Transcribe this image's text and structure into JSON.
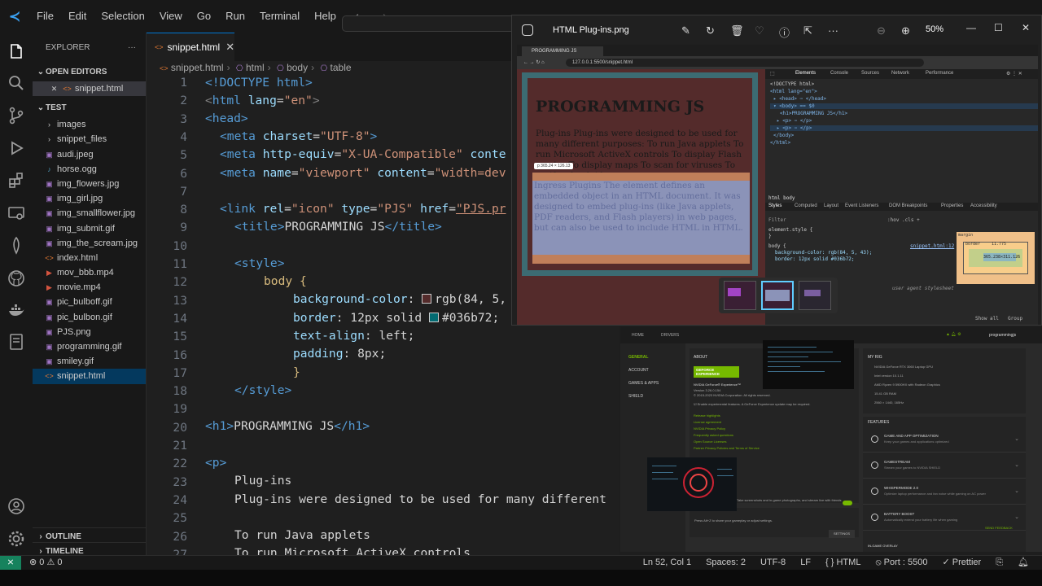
{
  "vscode": {
    "menu": [
      "File",
      "Edit",
      "Selection",
      "View",
      "Go",
      "Run",
      "Terminal",
      "Help"
    ],
    "explorer_title": "EXPLORER",
    "explorer_more": "···",
    "open_editors_title": "OPEN EDITORS",
    "open_editors": [
      "snippet.html"
    ],
    "folder_name": "TEST",
    "files": [
      {
        "name": "images",
        "kind": "folder"
      },
      {
        "name": "snippet_files",
        "kind": "folder"
      },
      {
        "name": "audi.jpeg",
        "kind": "img"
      },
      {
        "name": "horse.ogg",
        "kind": "ogg"
      },
      {
        "name": "img_flowers.jpg",
        "kind": "img"
      },
      {
        "name": "img_girl.jpg",
        "kind": "img"
      },
      {
        "name": "img_smallflower.jpg",
        "kind": "img"
      },
      {
        "name": "img_submit.gif",
        "kind": "img"
      },
      {
        "name": "img_the_scream.jpg",
        "kind": "img"
      },
      {
        "name": "index.html",
        "kind": "html"
      },
      {
        "name": "mov_bbb.mp4",
        "kind": "mp4"
      },
      {
        "name": "movie.mp4",
        "kind": "mp4"
      },
      {
        "name": "pic_bulboff.gif",
        "kind": "img"
      },
      {
        "name": "pic_bulbon.gif",
        "kind": "img"
      },
      {
        "name": "PJS.png",
        "kind": "img"
      },
      {
        "name": "programming.gif",
        "kind": "img"
      },
      {
        "name": "smiley.gif",
        "kind": "img"
      },
      {
        "name": "snippet.html",
        "kind": "html"
      }
    ],
    "outline": "OUTLINE",
    "timeline": "TIMELINE",
    "tab_label": "snippet.html",
    "breadcrumb": [
      "snippet.html",
      "html",
      "body",
      "table"
    ],
    "line_numbers": [
      "1",
      "2",
      "3",
      "4",
      "5",
      "6",
      "7",
      "8",
      "9",
      "10",
      "11",
      "12",
      "13",
      "14",
      "15",
      "16",
      "17",
      "18",
      "19",
      "20",
      "21",
      "22",
      "23",
      "24",
      "25",
      "26",
      "27"
    ],
    "code": {
      "l1": "<!DOCTYPE html>",
      "l2a": "<",
      "l2b": "html",
      "l2c": " lang",
      "l2d": "=",
      "l2e": "\"en\"",
      "l2f": ">",
      "l3": "<head>",
      "l4a": "<meta",
      "l4b": " charset",
      "l4c": "=",
      "l4d": "\"UTF-8\"",
      "l4e": ">",
      "l5a": "<meta",
      "l5b": " http-equiv",
      "l5c": "=",
      "l5d": "\"X-UA-Compatible\"",
      "l5e": " conte",
      "l6a": "<meta",
      "l6b": " name",
      "l6c": "=",
      "l6d": "\"viewport\"",
      "l6e": " content",
      "l6f": "=",
      "l6g": "\"width=dev",
      "l8a": "<link",
      "l8b": " rel",
      "l8c": "=",
      "l8d": "\"icon\"",
      "l8e": " type",
      "l8f": "=",
      "l8g": "\"PJS\"",
      "l8h": " href",
      "l8i": "=",
      "l8j": "\"PJS.pr",
      "l9a": "<title>",
      "l9b": "PROGRAMMING JS",
      "l9c": "</title>",
      "l11": "<style>",
      "l12a": "body",
      "l12b": " {",
      "l13a": "background-color",
      "l13b": ": ",
      "l13c": "rgb(84, 5,",
      "l14a": "border",
      "l14b": ": 12px solid ",
      "l14c": "#036b72;",
      "l15a": "text-align",
      "l15b": ": left;",
      "l16a": "padding",
      "l16b": ": 8px;",
      "l17": "}",
      "l18": "</style>",
      "l20a": "<h1>",
      "l20b": "PROGRAMMING JS",
      "l20c": "</h1>",
      "l22": "<p>",
      "l23": "Plug-ins",
      "l24": "Plug-ins were designed to be used for many different",
      "l26": "To run Java applets",
      "l27": "To run Microsoft ActiveX controls"
    },
    "swatch_bg": "#542b2b",
    "swatch_border": "#036b72",
    "status": {
      "remote": "⨯",
      "problems": "⊗ 0  ⚠ 0",
      "position": "Ln 52, Col 1",
      "spaces": "Spaces: 2",
      "encoding": "UTF-8",
      "eol": "LF",
      "language": "{ } HTML",
      "port": "⦸ Port : 5500",
      "prettier": "✓ Prettier"
    }
  },
  "photos": {
    "filename": "HTML Plug-ins.png",
    "zoom": "50%",
    "browser": {
      "tab": "PROGRAMMING JS",
      "url": "127.0.0.1:5500/snippet.html",
      "h1": "PROGRAMMING JS",
      "p1": "Plug-ins Plug-ins were designed to be used for many different purposes: To run Java applets To run Microsoft ActiveX controls To display Flash movies To display maps To scan for viruses To verify a bank id",
      "tooltip": "p  365.24 × 126.13",
      "p2": "Ingress Plugins The element defines an embedded object in an HTML document. It was designed to embed plug-ins (like Java applets, PDF readers, and Flash players) in web pages, but can also be used to include HTML in HTML."
    },
    "devtools": {
      "tabs": [
        "Elements",
        "Console",
        "Sources",
        "Network",
        "Performance"
      ],
      "dom": [
        "<!DOCTYPE html>",
        "<html lang=\"en\">",
        "▸ <head> ⋯ </head>",
        "▾ <body> == $0",
        "<h1>PROGRAMMING JS</h1>",
        "▸ <p> ⋯ </p>",
        "▸ <p> ⋯ </p>",
        "</body>",
        "</html>"
      ],
      "breadcrumb": [
        "html",
        "body"
      ],
      "subtabs": [
        "Styles",
        "Computed",
        "Layout",
        "Event Listeners",
        "DOM Breakpoints",
        "Properties",
        "Accessibility"
      ],
      "filter": "Filter",
      "filter_opts": ":hov  .cls  +",
      "rule1": "element.style {",
      "rule1_close": "}",
      "rule2_sel": "body {",
      "rule2_src": "snippet.html:12",
      "rule2_p1": "background-color: rgb(84, 5, 43);",
      "rule2_p2": "border: 12px solid #036b72;",
      "ua": "user agent stylesheet",
      "box_margin": "margin",
      "box_border": "border",
      "box_padding": "padding",
      "box_content": "365.238×311.126",
      "box_val": "11.775",
      "box_pad_val": "8",
      "show_all": "Show all",
      "group": "Group"
    }
  },
  "nvidia": {
    "nav_top": [
      "HOME",
      "DRIVERS"
    ],
    "user": "programmingjs",
    "nav": [
      "GENERAL",
      "ACCOUNT",
      "GAMES & APPS",
      "SHIELD"
    ],
    "about": "ABOUT",
    "badge": "GEFORCE EXPERIENCE",
    "app_name": "NVIDIA GeForce® Experience™",
    "version": "Version 3.26.0.154",
    "copyright": "© 2015-2023 NVIDIA Corporation. All rights reserved.",
    "beta": "Enable experimental features. A GeForce Experience update may be required.",
    "links": [
      "Release highlights",
      "License agreement",
      "NVIDIA Privacy Policy",
      "Frequently asked questions",
      "Open Source Licenses",
      "Partner Privacy Policies and Terms of Service"
    ],
    "myrig": "MY RIG",
    "rig": [
      "NVIDIA GeForce RTX 3060 Laptop GPU",
      "Intel version 10.1.11",
      "AMD Ryzen 9 5900HX with Radeon Graphics",
      "15.41 GB RAM",
      "2560 × 1440, 165Hz"
    ],
    "features": "FEATURES",
    "feature_list": [
      {
        "t": "GAME AND APP OPTIMIZATION",
        "d": "Keep your games and applications optimized"
      },
      {
        "t": "GAMESTREAM",
        "d": "Stream your games to NVIDIA SHIELD"
      },
      {
        "t": "WHISPERMODE 2.0",
        "d": "Optimize laptop performance and fan noise while gaming on AC power"
      },
      {
        "t": "BATTERY BOOST",
        "d": "Automatically extend your battery life when gaming"
      }
    ],
    "ingame": "IN-GAME OVERLAY",
    "send_feedback": "SEND FEEDBACK",
    "share_text": "Press Alt+Z to share your gameplay or adjust settings.",
    "share_text2": "Take screenshots and in-game photographs, and stream live with friends",
    "settings_btn": "SETTINGS"
  }
}
